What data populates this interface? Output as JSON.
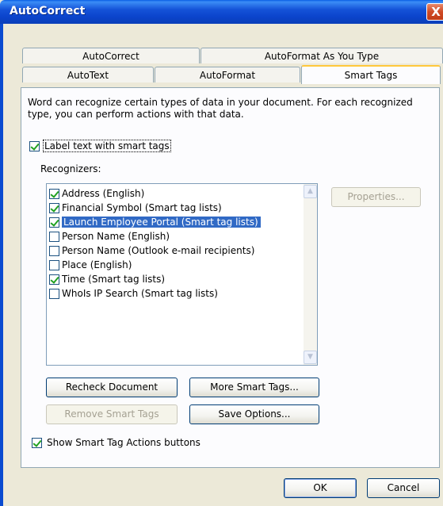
{
  "window": {
    "title": "AutoCorrect",
    "close_glyph": "X"
  },
  "tabs_back": [
    "AutoCorrect",
    "AutoFormat As You Type"
  ],
  "tabs_front": [
    "AutoText",
    "AutoFormat",
    "Smart Tags"
  ],
  "active_tab": "Smart Tags",
  "description": "Word can recognize certain types of data in your document. For each recognized type, you can perform actions with that data.",
  "label_smart_tags": {
    "label": "Label text with smart tags",
    "checked": true
  },
  "recognizers_label": "Recognizers:",
  "recognizers": [
    {
      "label": "Address (English)",
      "checked": true,
      "selected": false
    },
    {
      "label": "Financial Symbol (Smart tag lists)",
      "checked": true,
      "selected": false
    },
    {
      "label": "Launch Employee Portal (Smart tag lists)",
      "checked": true,
      "selected": true
    },
    {
      "label": "Person Name (English)",
      "checked": false,
      "selected": false
    },
    {
      "label": "Person Name (Outlook e-mail recipients)",
      "checked": false,
      "selected": false
    },
    {
      "label": "Place (English)",
      "checked": false,
      "selected": false
    },
    {
      "label": "Time (Smart tag lists)",
      "checked": true,
      "selected": false
    },
    {
      "label": "WhoIs IP Search (Smart tag lists)",
      "checked": false,
      "selected": false
    }
  ],
  "buttons": {
    "properties": "Properties...",
    "recheck": "Recheck Document",
    "more_smart_tags": "More Smart Tags...",
    "remove_smart_tags": "Remove Smart Tags",
    "save_options": "Save Options...",
    "ok": "OK",
    "cancel": "Cancel"
  },
  "show_actions": {
    "label": "Show Smart Tag Actions buttons",
    "checked": true
  }
}
